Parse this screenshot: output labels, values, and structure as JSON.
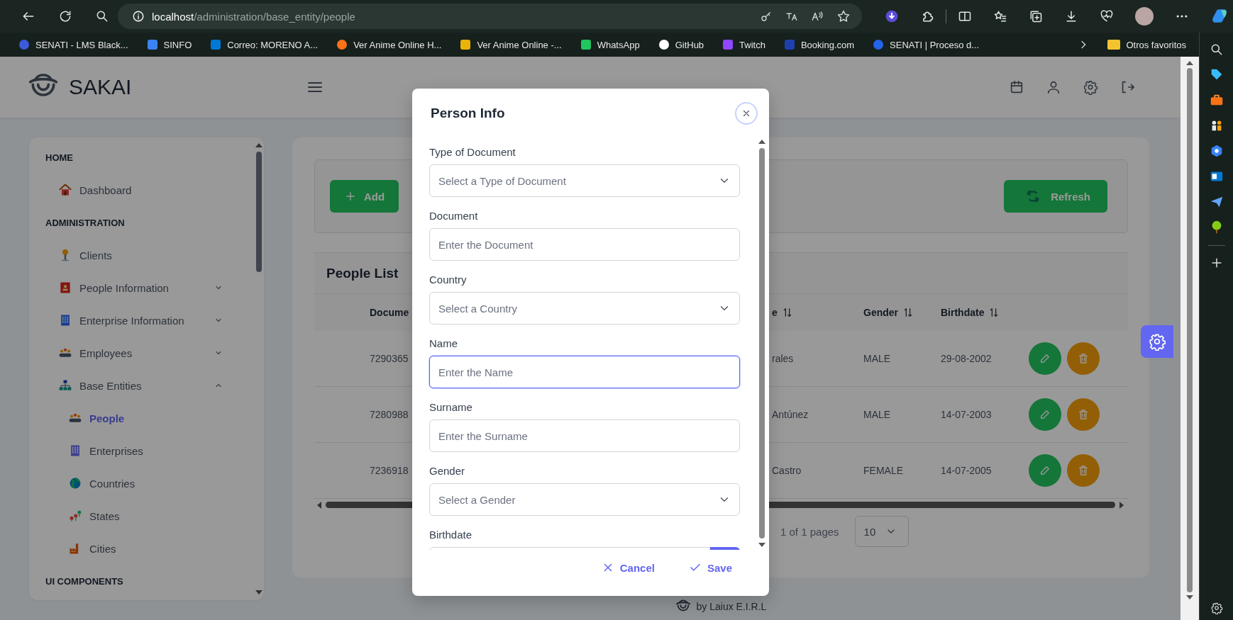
{
  "browser": {
    "url_host": "localhost",
    "url_path": "/administration/base_entity/people",
    "bookmarks": [
      "SENATI - LMS Black...",
      "SINFO",
      "Correo: MORENO A...",
      "Ver Anime Online H...",
      "Ver Anime Online -...",
      "WhatsApp",
      "GitHub",
      "Twitch",
      "Booking.com",
      "SENATI | Proceso d..."
    ],
    "other_bookmarks": "Otros favoritos"
  },
  "app": {
    "brand": "SAKAI",
    "footer": "by Laiux E.I.R.L"
  },
  "sidebar": {
    "sections": [
      {
        "title": "HOME",
        "items": [
          {
            "label": "Dashboard",
            "selected": false
          }
        ]
      },
      {
        "title": "ADMINISTRATION",
        "items": [
          {
            "label": "Clients",
            "selected": false
          },
          {
            "label": "People Information",
            "selected": false,
            "expanded": false
          },
          {
            "label": "Enterprise Information",
            "selected": false,
            "expanded": false
          },
          {
            "label": "Employees",
            "selected": false,
            "expanded": false
          },
          {
            "label": "Base Entities",
            "selected": false,
            "expanded": true,
            "children": [
              {
                "label": "People",
                "selected": true
              },
              {
                "label": "Enterprises",
                "selected": false
              },
              {
                "label": "Countries",
                "selected": false
              },
              {
                "label": "States",
                "selected": false
              },
              {
                "label": "Cities",
                "selected": false
              }
            ]
          }
        ]
      },
      {
        "title": "UI COMPONENTS"
      }
    ]
  },
  "toolbar": {
    "buttons": [
      {
        "label": "Add",
        "kind": "add"
      },
      {
        "label": "Refresh",
        "kind": "refresh"
      }
    ]
  },
  "table": {
    "title": "People List",
    "columns": [
      {
        "label": "Docume"
      },
      {
        "label": "e",
        "sortable": true
      },
      {
        "label": "Gender",
        "sortable": true
      },
      {
        "label": "Birthdate",
        "sortable": true
      }
    ],
    "rows": [
      {
        "cells": [
          "7290365",
          "rales",
          "MALE",
          "29-08-2002"
        ]
      },
      {
        "cells": [
          "7280988",
          "Antúnez",
          "MALE",
          "14-07-2003"
        ]
      },
      {
        "cells": [
          "7236918",
          "Castro",
          "FEMALE",
          "14-07-2005"
        ]
      }
    ],
    "pagination": {
      "summary": "1 of 1 pages",
      "rows_per_page": "10"
    }
  },
  "dialog": {
    "title": "Person Info",
    "fields": [
      {
        "label": "Type of Document",
        "kind": "select",
        "placeholder": "Select a Type of Document",
        "focused": false
      },
      {
        "label": "Document",
        "kind": "text",
        "placeholder": "Enter the Document",
        "focused": false
      },
      {
        "label": "Country",
        "kind": "select",
        "placeholder": "Select a Country",
        "focused": false
      },
      {
        "label": "Name",
        "kind": "text",
        "placeholder": "Enter the Name",
        "focused": true
      },
      {
        "label": "Surname",
        "kind": "text",
        "placeholder": "Enter the Surname",
        "focused": false
      },
      {
        "label": "Gender",
        "kind": "select",
        "placeholder": "Select a Gender",
        "focused": false
      },
      {
        "label": "Birthdate",
        "kind": "date"
      }
    ],
    "actions": [
      {
        "label": "Cancel",
        "kind": "cancel"
      },
      {
        "label": "Save",
        "kind": "save"
      }
    ]
  }
}
